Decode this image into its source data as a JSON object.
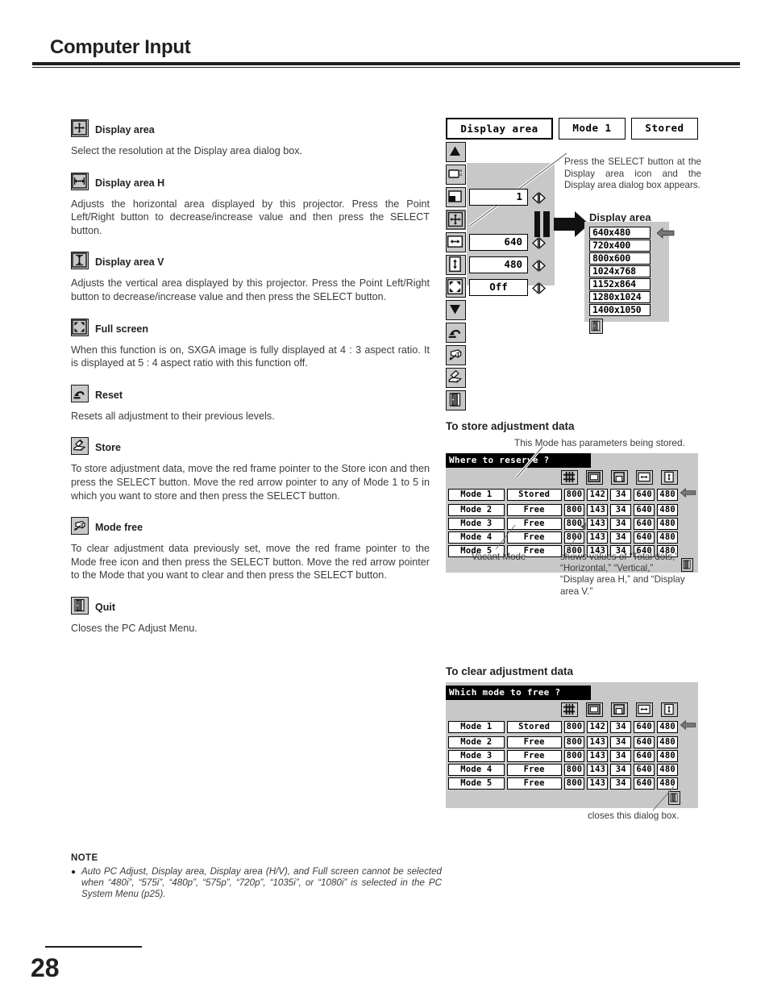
{
  "header": {
    "title": "Computer Input"
  },
  "page": {
    "number": "28"
  },
  "sections": [
    {
      "icon": "display-area-icon",
      "title": "Display area",
      "body": "Select the resolution at the Display area dialog box."
    },
    {
      "icon": "display-area-h-icon",
      "title": "Display area H",
      "body": "Adjusts the horizontal area displayed by this projector.  Press the Point Left/Right button to decrease/increase value and then press the SELECT button."
    },
    {
      "icon": "display-area-v-icon",
      "title": "Display area V",
      "body": "Adjusts the vertical area displayed by this projector.  Press the Point Left/Right button to decrease/increase value and then press the SELECT button."
    },
    {
      "icon": "full-screen-icon",
      "title": "Full screen",
      "body": "When this function is on, SXGA image is fully displayed at 4 : 3 aspect ratio.  It is displayed at 5 : 4 aspect ratio with this function off."
    },
    {
      "icon": "reset-icon",
      "title": "Reset",
      "body": "Resets all adjustment to their previous levels."
    },
    {
      "icon": "store-icon",
      "title": "Store",
      "body": "To store adjustment data, move the red frame pointer to the Store icon and then press the SELECT button.  Move the red arrow pointer to any of Mode 1 to 5 in which you want to store  and then press the SELECT button."
    },
    {
      "icon": "mode-free-icon",
      "title": "Mode free",
      "body": "To clear adjustment data previously set, move the red frame pointer to the Mode free icon and then press the SELECT button.  Move the red arrow pointer to the Mode that you want to clear and then press the SELECT button."
    },
    {
      "icon": "quit-icon",
      "title": "Quit",
      "body": "Closes the PC Adjust Menu."
    }
  ],
  "osd": {
    "title": "Display area",
    "mode": "Mode 1",
    "status": "Stored",
    "rows": [
      {
        "icon": "total-dots-icon",
        "value": "1"
      },
      {
        "icon": "display-area-icon",
        "value": ""
      },
      {
        "icon": "display-area-h-icon",
        "value": "640"
      },
      {
        "icon": "display-area-v-icon",
        "value": "480"
      },
      {
        "icon": "full-screen-icon",
        "value": "Off"
      }
    ],
    "callout": "Press the SELECT button at the Display area icon and the Display area dialog box appears."
  },
  "display_area_dialog": {
    "title": "Display area",
    "options": [
      "640x480",
      "720x400",
      "800x600",
      "1024x768",
      "1152x864",
      "1280x1024",
      "1400x1050"
    ],
    "quit_icon": "quit-icon",
    "pointer_icon": "left-arrow-pointer-icon"
  },
  "store_section": {
    "heading": "To store adjustment data",
    "note_top": "This Mode has parameters being stored.",
    "dialog_bar": "Where to reserve ?",
    "column_icons": [
      "total-dots-icon",
      "horizontal-icon",
      "vertical-icon",
      "display-area-h-icon",
      "display-area-v-icon"
    ],
    "rows": [
      {
        "mode": "Mode 1",
        "state": "Stored",
        "values": [
          "800",
          "142",
          "34",
          "640",
          "480"
        ],
        "pointer": true
      },
      {
        "mode": "Mode 2",
        "state": "Free",
        "values": [
          "800",
          "143",
          "34",
          "640",
          "480"
        ],
        "pointer": false
      },
      {
        "mode": "Mode 3",
        "state": "Free",
        "values": [
          "800",
          "143",
          "34",
          "640",
          "480"
        ],
        "pointer": false
      },
      {
        "mode": "Mode 4",
        "state": "Free",
        "values": [
          "800",
          "143",
          "34",
          "640",
          "480"
        ],
        "pointer": false
      },
      {
        "mode": "Mode 5",
        "state": "Free",
        "values": [
          "800",
          "143",
          "34",
          "640",
          "480"
        ],
        "pointer": false
      }
    ],
    "note_vacant": "Vacant Mode",
    "note_values": "shows values of “Total dots,” “Horizontal,” “Vertical,” “Display area H,” and “Display area V.”"
  },
  "clear_section": {
    "heading": "To clear adjustment data",
    "dialog_bar": "Which mode to free ?",
    "column_icons": [
      "total-dots-icon",
      "horizontal-icon",
      "vertical-icon",
      "display-area-h-icon",
      "display-area-v-icon"
    ],
    "rows": [
      {
        "mode": "Mode 1",
        "state": "Stored",
        "values": [
          "800",
          "142",
          "34",
          "640",
          "480"
        ],
        "pointer": true
      },
      {
        "mode": "Mode 2",
        "state": "Free",
        "values": [
          "800",
          "143",
          "34",
          "640",
          "480"
        ],
        "pointer": false
      },
      {
        "mode": "Mode 3",
        "state": "Free",
        "values": [
          "800",
          "143",
          "34",
          "640",
          "480"
        ],
        "pointer": false
      },
      {
        "mode": "Mode 4",
        "state": "Free",
        "values": [
          "800",
          "143",
          "34",
          "640",
          "480"
        ],
        "pointer": false
      },
      {
        "mode": "Mode 5",
        "state": "Free",
        "values": [
          "800",
          "143",
          "34",
          "640",
          "480"
        ],
        "pointer": false
      }
    ],
    "note_quit": "closes this dialog box."
  },
  "note": {
    "heading": "NOTE",
    "bullet": "●",
    "text": "Auto PC Adjust, Display area, Display area (H/V), and Full screen cannot be selected when “480i”, “575i”, “480p”, “575p”, “720p”, “1035i”, or “1080i” is selected in the PC System Menu (p25)."
  },
  "colors": {
    "ink": "#231f20",
    "osd_grey": "#c8c8c8",
    "body_text": "#3b3b3b"
  }
}
